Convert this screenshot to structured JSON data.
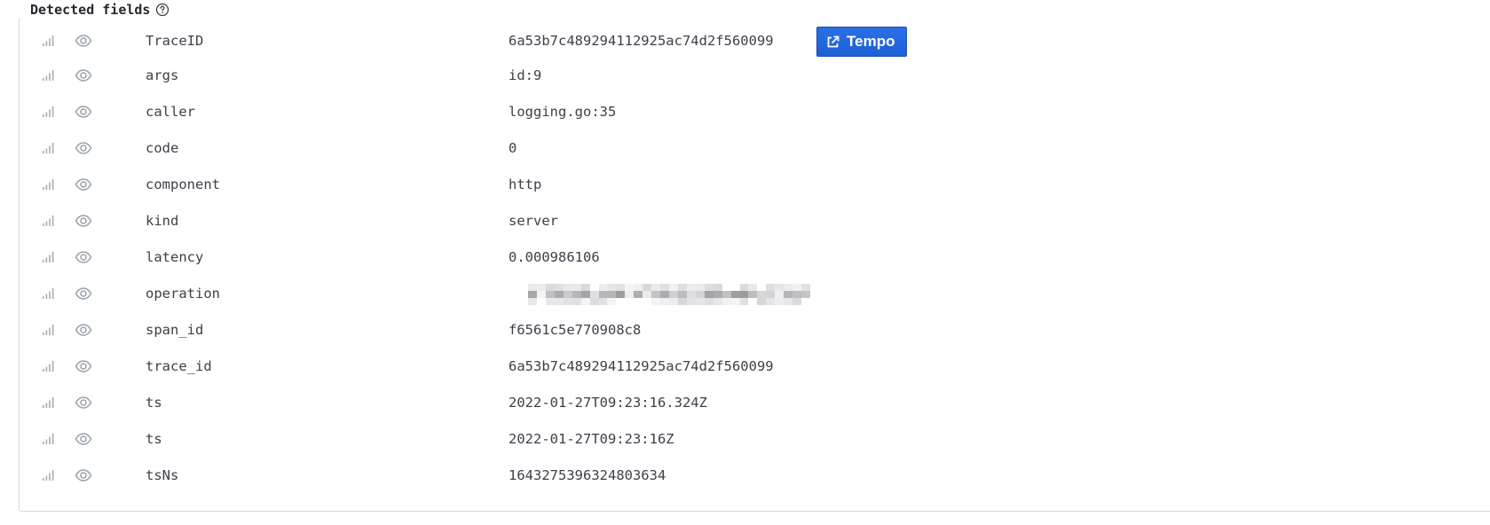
{
  "section": {
    "title": "Detected fields"
  },
  "icons": {
    "help": "help-circle-icon",
    "stats": "signal-bars-icon",
    "toggle": "eye-icon",
    "external": "external-link-icon"
  },
  "colors": {
    "link_button": "#1f62e0",
    "icon_gray": "#9aa1ad",
    "text": "#3d4049"
  },
  "fields": [
    {
      "key": "TraceID",
      "value": "6a53b7c489294112925ac74d2f560099",
      "link_label": "Tempo"
    },
    {
      "key": "args",
      "value": "id:9"
    },
    {
      "key": "caller",
      "value": "logging.go:35"
    },
    {
      "key": "code",
      "value": "0"
    },
    {
      "key": "component",
      "value": "http"
    },
    {
      "key": "kind",
      "value": "server"
    },
    {
      "key": "latency",
      "value": "0.000986106"
    },
    {
      "key": "operation",
      "value": "",
      "redacted": true
    },
    {
      "key": "span_id",
      "value": "f6561c5e770908c8"
    },
    {
      "key": "trace_id",
      "value": "6a53b7c489294112925ac74d2f560099"
    },
    {
      "key": "ts",
      "value": "2022-01-27T09:23:16.324Z"
    },
    {
      "key": "ts",
      "value": "2022-01-27T09:23:16Z"
    },
    {
      "key": "tsNs",
      "value": "1643275396324803634"
    }
  ]
}
